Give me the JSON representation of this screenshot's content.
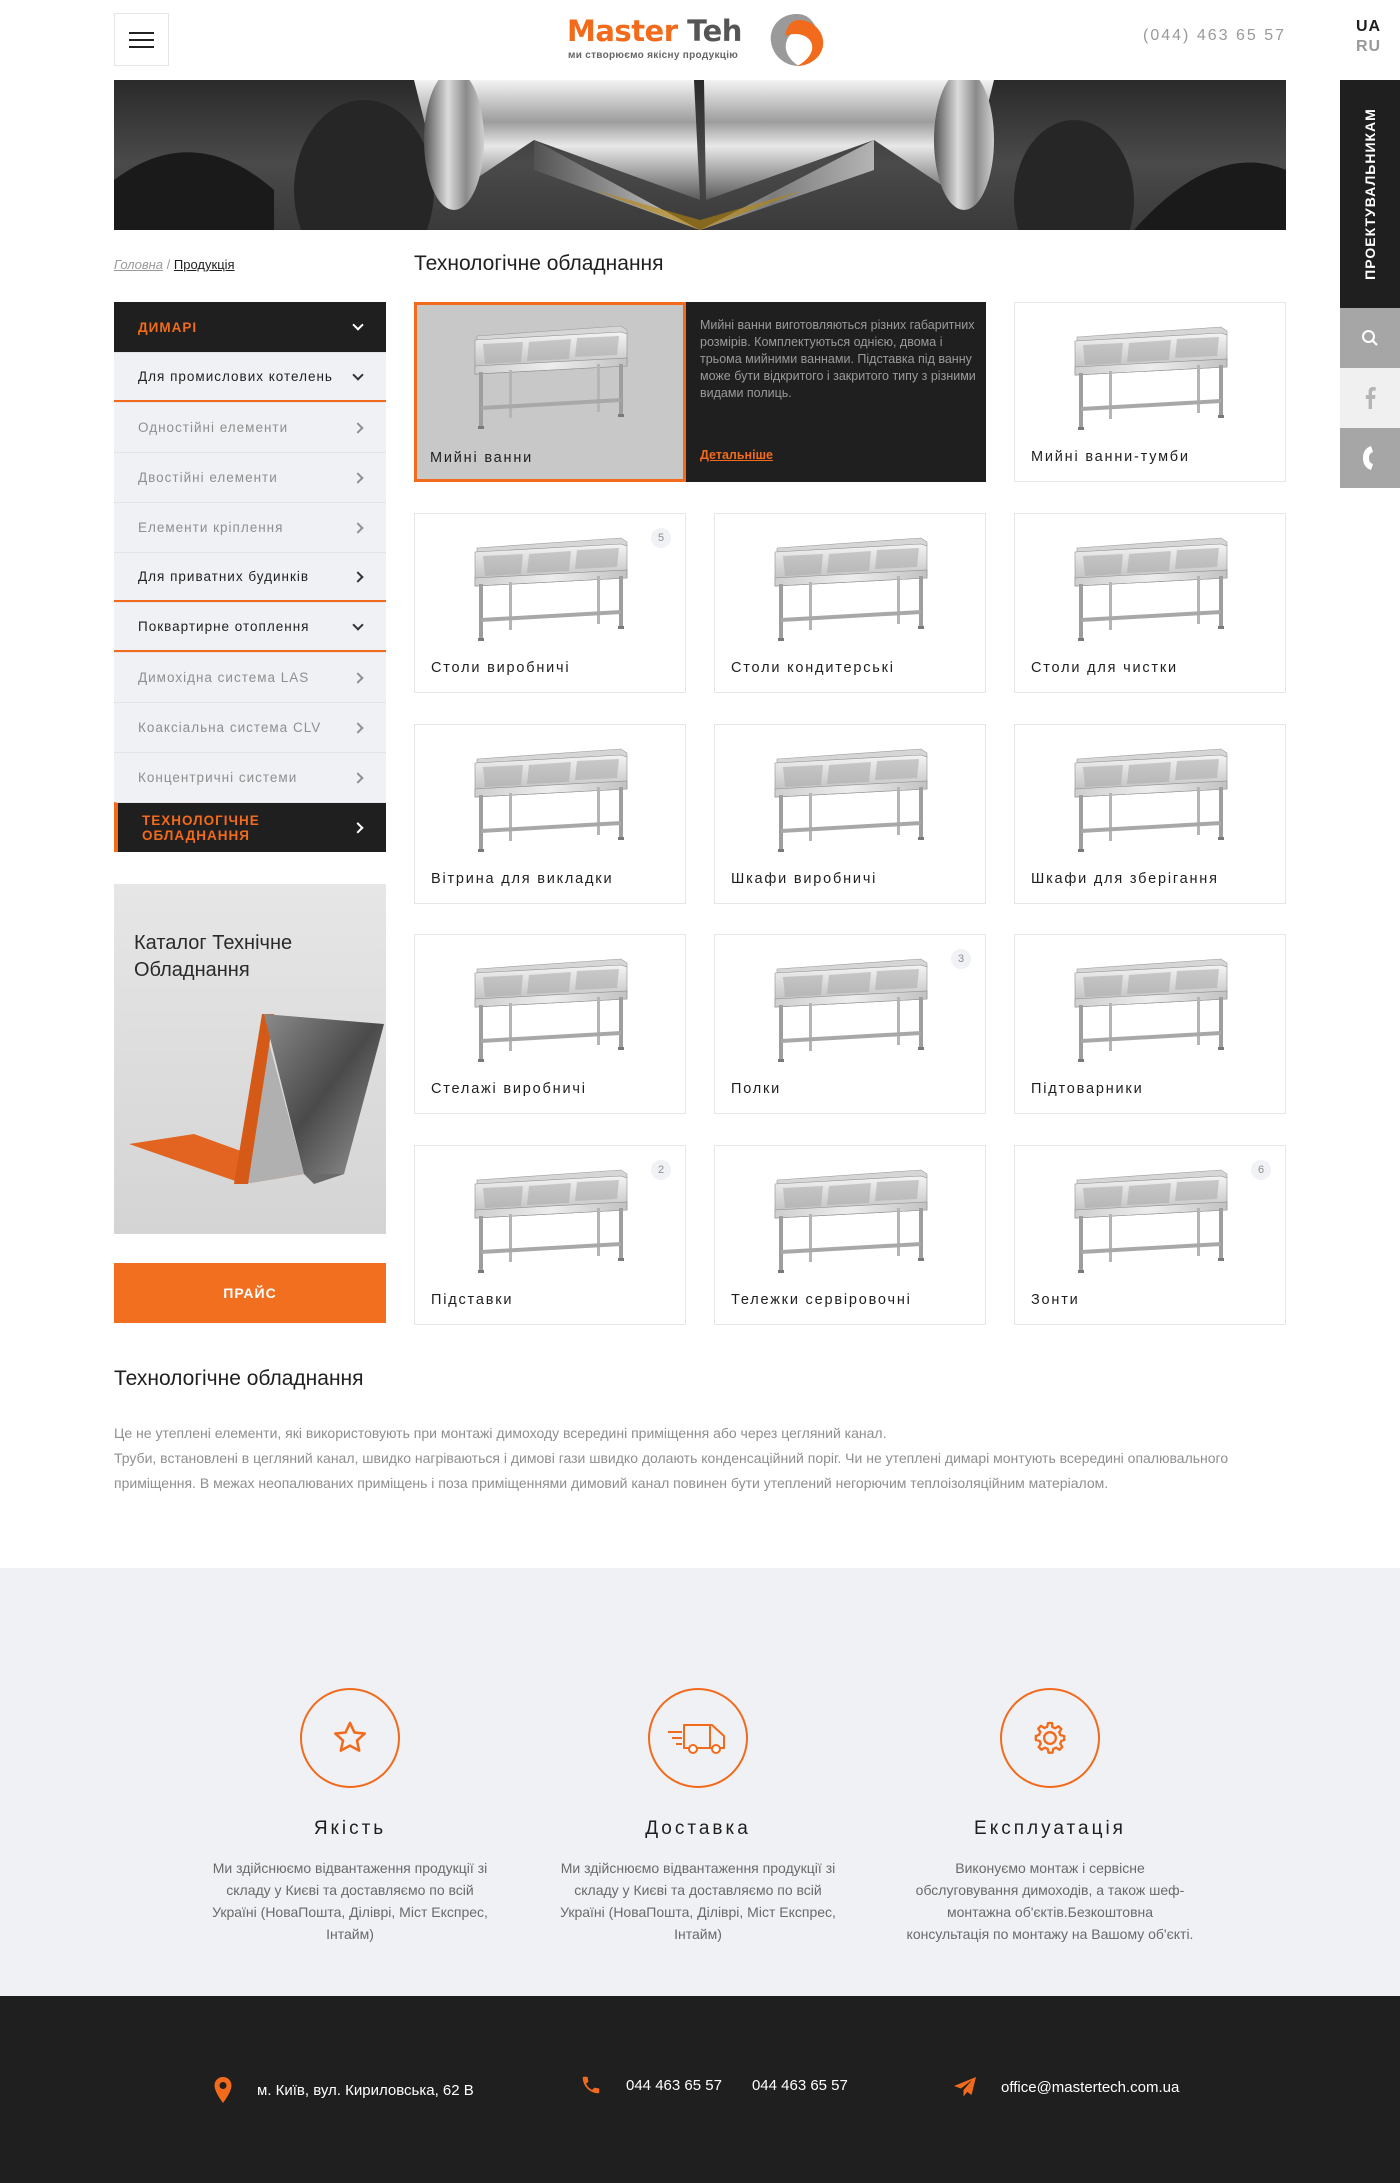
{
  "header": {
    "logo_title_a": "Master",
    "logo_title_b": "Teh",
    "logo_subtitle": "ми створюємо якісну продукцію",
    "phone": "(044) 463 65 57",
    "lang_active": "UA",
    "lang_other": "RU"
  },
  "side_tools": {
    "designers_label": "ПРОЕКТУВАЛЬНИКАМ",
    "icons": [
      "search-icon",
      "facebook-icon",
      "phone-icon"
    ]
  },
  "breadcrumb": {
    "home": "Головна",
    "separator": "/",
    "current": "Продукція"
  },
  "sidebar": {
    "items": [
      {
        "label": "ДИМАРІ",
        "style": "dark",
        "arrow": "down"
      },
      {
        "label": "Для промислових котелень",
        "style": "parent-open",
        "arrow": "down"
      },
      {
        "label": "Одностійні елементи",
        "style": "sub",
        "arrow": "right"
      },
      {
        "label": "Двостійні елементи",
        "style": "sub",
        "arrow": "right"
      },
      {
        "label": "Елементи кріплення",
        "style": "sub",
        "arrow": "right"
      },
      {
        "label": "Для приватних будинків",
        "style": "parent",
        "arrow": "right"
      },
      {
        "label": "Поквартирне отоплення",
        "style": "parent-open",
        "arrow": "down"
      },
      {
        "label": "Димохідна система LAS",
        "style": "sub",
        "arrow": "right"
      },
      {
        "label": "Коаксіальна система CLV",
        "style": "sub",
        "arrow": "right"
      },
      {
        "label": "Концентричні системи",
        "style": "sub",
        "arrow": "right"
      },
      {
        "label": "ТЕХНОЛОГІЧНЕ ОБЛАДНАННЯ",
        "style": "active",
        "arrow": "right"
      }
    ],
    "catalog_title": "Каталог Технічне Обладнання",
    "price_button": "ПРАЙС"
  },
  "main": {
    "title": "Технологічне обладнання",
    "featured": {
      "label": "Мийні ванни",
      "description": "Мийні ванни виготовляються різних габаритних розмірів. Комплектуються однією, двома і трьома мийними ваннами. Підставка під ванну може бути відкритого і закритого типу з різними видами полиць.",
      "more_link": "Детальніше"
    },
    "products": [
      {
        "label": "Мийні ванни-тумби",
        "count": ""
      },
      {
        "label": "Столи виробничі",
        "count": "5"
      },
      {
        "label": "Столи кондитерські",
        "count": ""
      },
      {
        "label": "Столи для чистки",
        "count": ""
      },
      {
        "label": "Вітрина для викладки",
        "count": ""
      },
      {
        "label": "Шкафи виробничі",
        "count": ""
      },
      {
        "label": "Шкафи для зберігання",
        "count": ""
      },
      {
        "label": "Стелажі виробничі",
        "count": ""
      },
      {
        "label": "Полки",
        "count": "3"
      },
      {
        "label": "Підтоварники",
        "count": ""
      },
      {
        "label": "Підставки",
        "count": "2"
      },
      {
        "label": "Тележки сервіровочні",
        "count": ""
      },
      {
        "label": "Зонти",
        "count": "6"
      }
    ]
  },
  "description": {
    "title": "Технологічне обладнання",
    "line1": "Це не утеплені елементи, які використовують при монтажі димоходу всередині приміщення або через цегляний канал.",
    "line2": "Труби, встановлені в цегляний канал, швидко нагріваються і димові гази швидко долають конденсаційний поріг. Чи не утеплені димарі монтують всередині опалювального приміщення. В межах неопалюваних приміщень і поза приміщеннями димовий канал повинен бути утеплений негорючим теплоізоляційним матеріалом."
  },
  "features": [
    {
      "icon": "star-icon",
      "title": "Якість",
      "text": "Ми здійснюємо відвантаження продукції зі складу у Києві та доставляємо по всій Україні  (НоваПошта, Діліврі, Міст Експрес, Інтайм)"
    },
    {
      "icon": "truck-icon",
      "title": "Доставка",
      "text": "Ми здійснюємо відвантаження продукції зі складу у Києві та доставляємо по всій Україні  (НоваПошта, Діліврі, Міст Експрес, Інтайм)"
    },
    {
      "icon": "gear-icon",
      "title": "Експлуатація",
      "text": "Виконуємо монтаж і сервісне обслуговування димоходів, а також шеф-монтажна об'єктів.Безкоштовна консультація по монтажу на Вашому об'єкті."
    }
  ],
  "footer": {
    "address": "м. Київ, вул. Кириловська, 62 В",
    "phone1": "044 463 65 57",
    "phone2": "044 463 65 57",
    "email": "office@mastertech.com.ua"
  },
  "colors": {
    "accent": "#f26a1b",
    "dark": "#1f1f1f",
    "light_bg": "#eff1f5"
  }
}
